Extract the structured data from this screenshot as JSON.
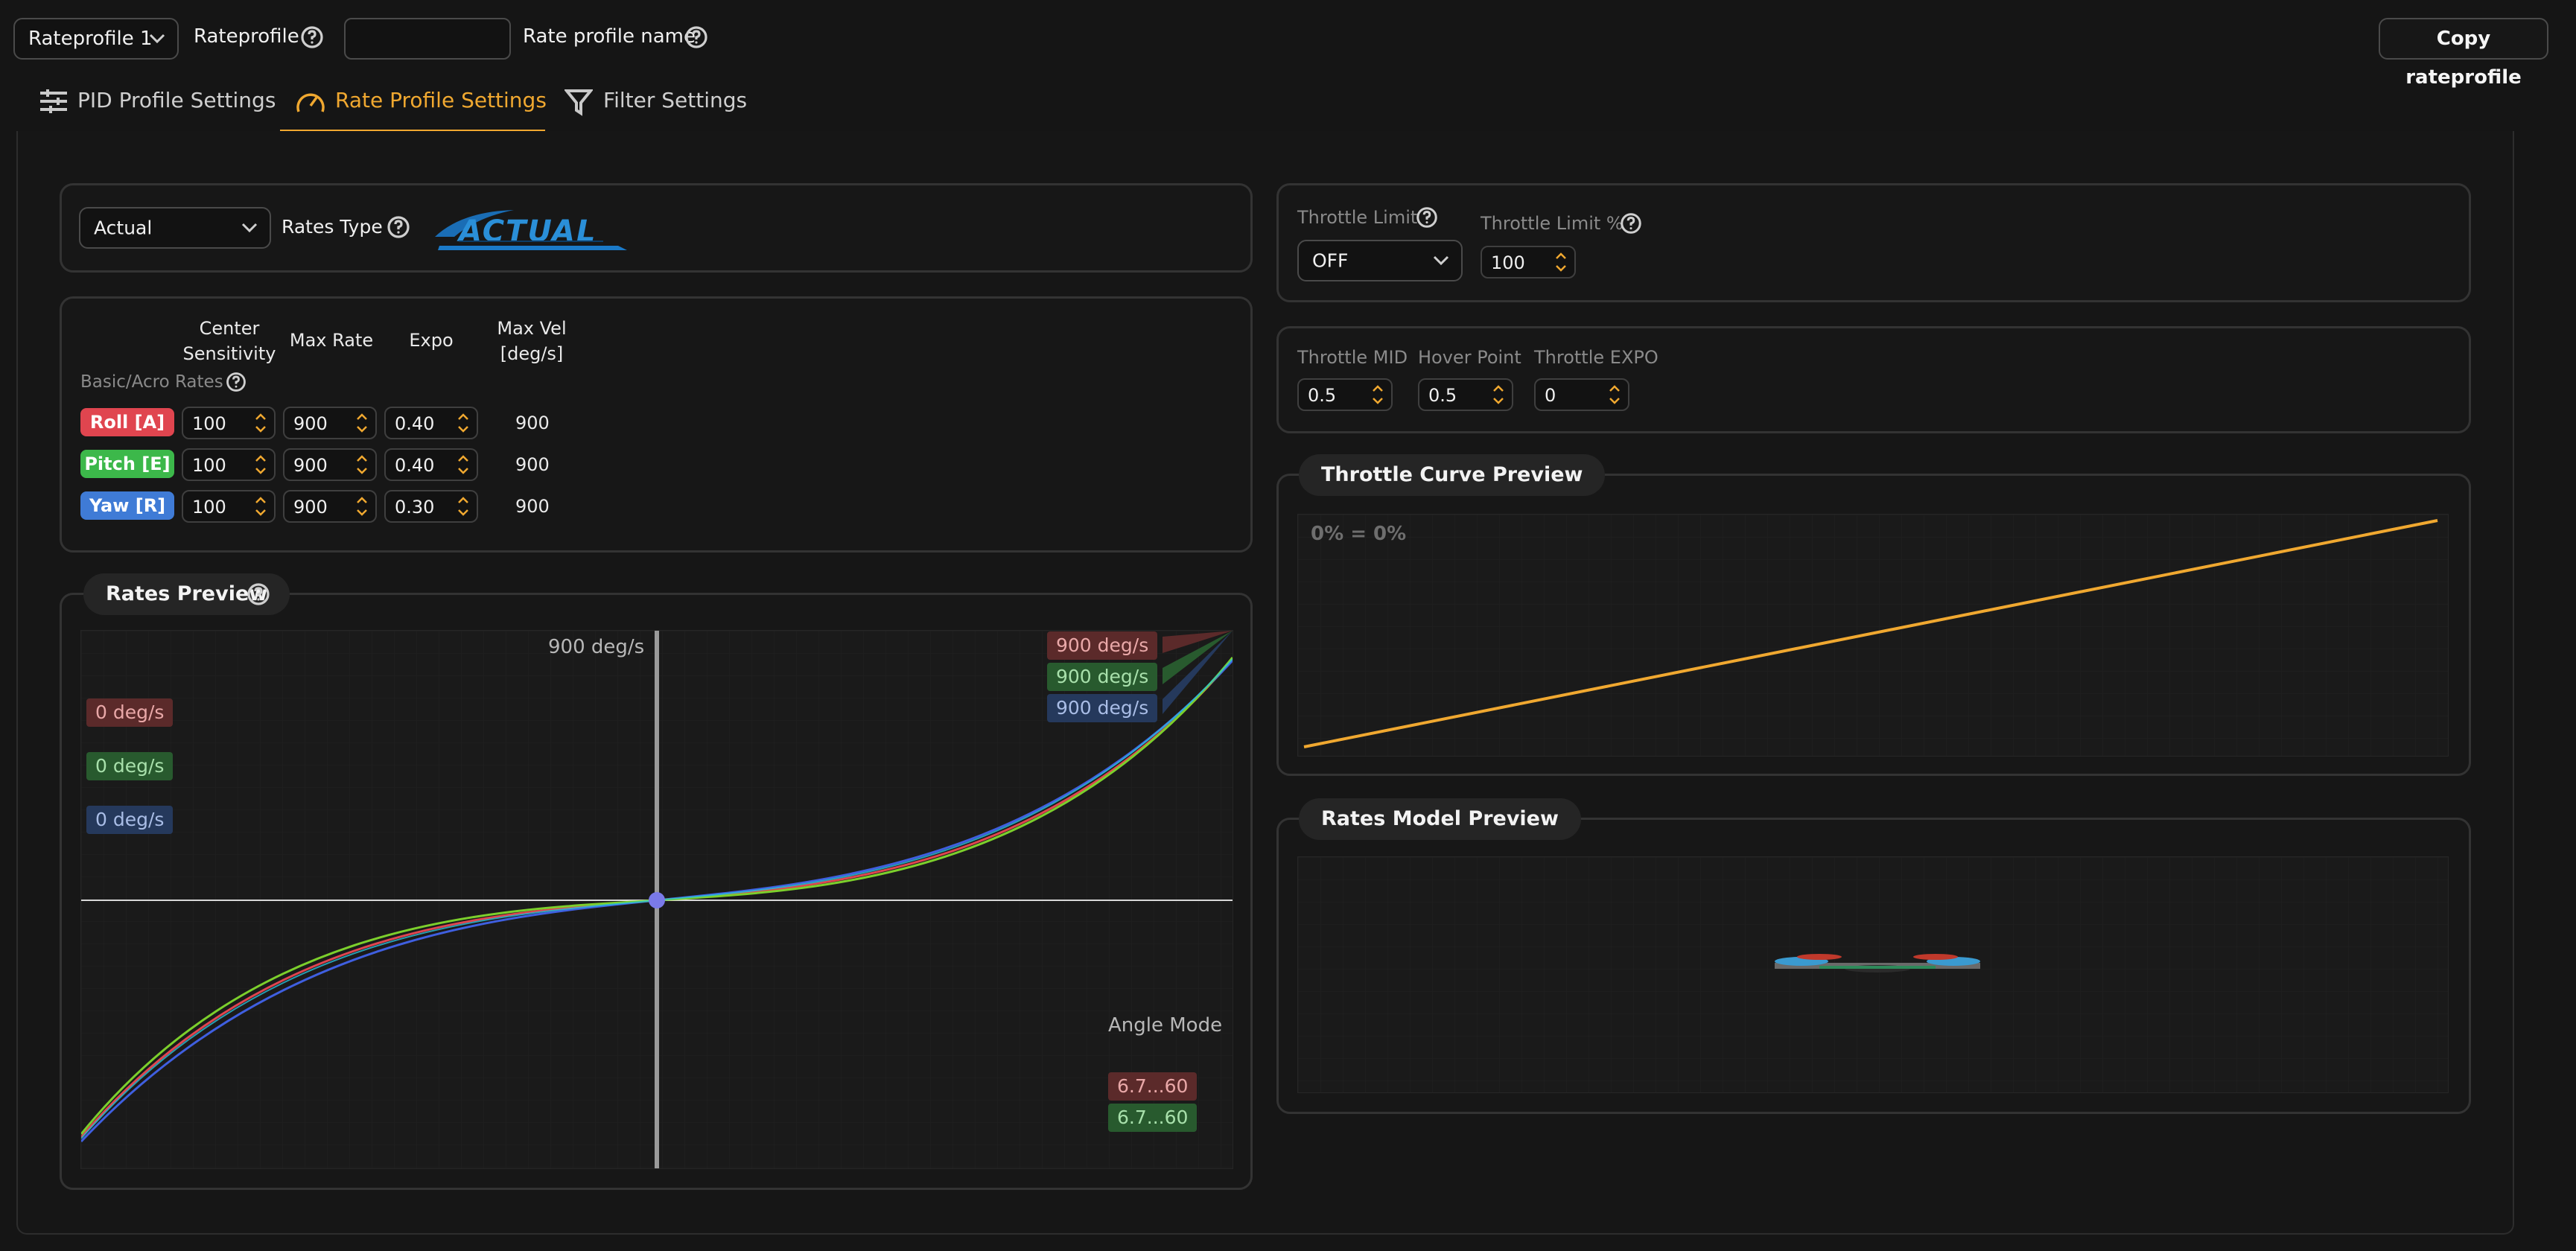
{
  "header": {
    "profile_select": "Rateprofile 1",
    "rateprofile_label": "Rateprofile",
    "rate_profile_name_label": "Rate profile name",
    "rate_profile_name_value": "",
    "copy_button": "Copy rateprofile"
  },
  "tabs": [
    {
      "label": "PID Profile Settings",
      "icon": "sliders-icon",
      "active": false
    },
    {
      "label": "Rate Profile Settings",
      "icon": "gauge-icon",
      "active": true
    },
    {
      "label": "Filter Settings",
      "icon": "funnel-icon",
      "active": false
    }
  ],
  "rates_type": {
    "select": "Actual",
    "label": "Rates Type",
    "logo_text": "ACTUAL"
  },
  "rates_table": {
    "headers": [
      "Center\nSensitivity",
      "Max Rate",
      "Expo",
      "Max Vel\n[deg/s]"
    ],
    "section_label": "Basic/Acro Rates",
    "rows": [
      {
        "axis": "Roll [A]",
        "color": "#e0454f",
        "center": "100",
        "max_rate": "900",
        "expo": "0.40",
        "max_vel": "900"
      },
      {
        "axis": "Pitch [E]",
        "color": "#3cb84a",
        "center": "100",
        "max_rate": "900",
        "expo": "0.40",
        "max_vel": "900"
      },
      {
        "axis": "Yaw [R]",
        "color": "#3f7bd6",
        "center": "100",
        "max_rate": "900",
        "expo": "0.30",
        "max_vel": "900"
      }
    ]
  },
  "rates_preview": {
    "title": "Rates Preview",
    "top_label": "900 deg/s",
    "left_tags": [
      "0 deg/s",
      "0 deg/s",
      "0 deg/s"
    ],
    "right_tags": [
      "900 deg/s",
      "900 deg/s",
      "900 deg/s"
    ],
    "angle_mode_label": "Angle Mode",
    "angle_tags": [
      "6.7...60",
      "6.7...60"
    ]
  },
  "throttle_limit": {
    "limit_label": "Throttle Limit",
    "limit_select": "OFF",
    "limit_pct_label": "Throttle Limit %",
    "limit_pct_value": "100"
  },
  "throttle_settings": {
    "mid_label": "Throttle MID",
    "mid_value": "0.5",
    "hover_label": "Hover Point",
    "hover_value": "0.5",
    "expo_label": "Throttle EXPO",
    "expo_value": "0"
  },
  "throttle_curve": {
    "title": "Throttle Curve Preview",
    "readout": "0% = 0%"
  },
  "rates_model": {
    "title": "Rates Model Preview"
  },
  "colors": {
    "accent": "#f0a830",
    "roll": "#e0454f",
    "pitch": "#3cb84a",
    "yaw": "#3f7bd6"
  }
}
